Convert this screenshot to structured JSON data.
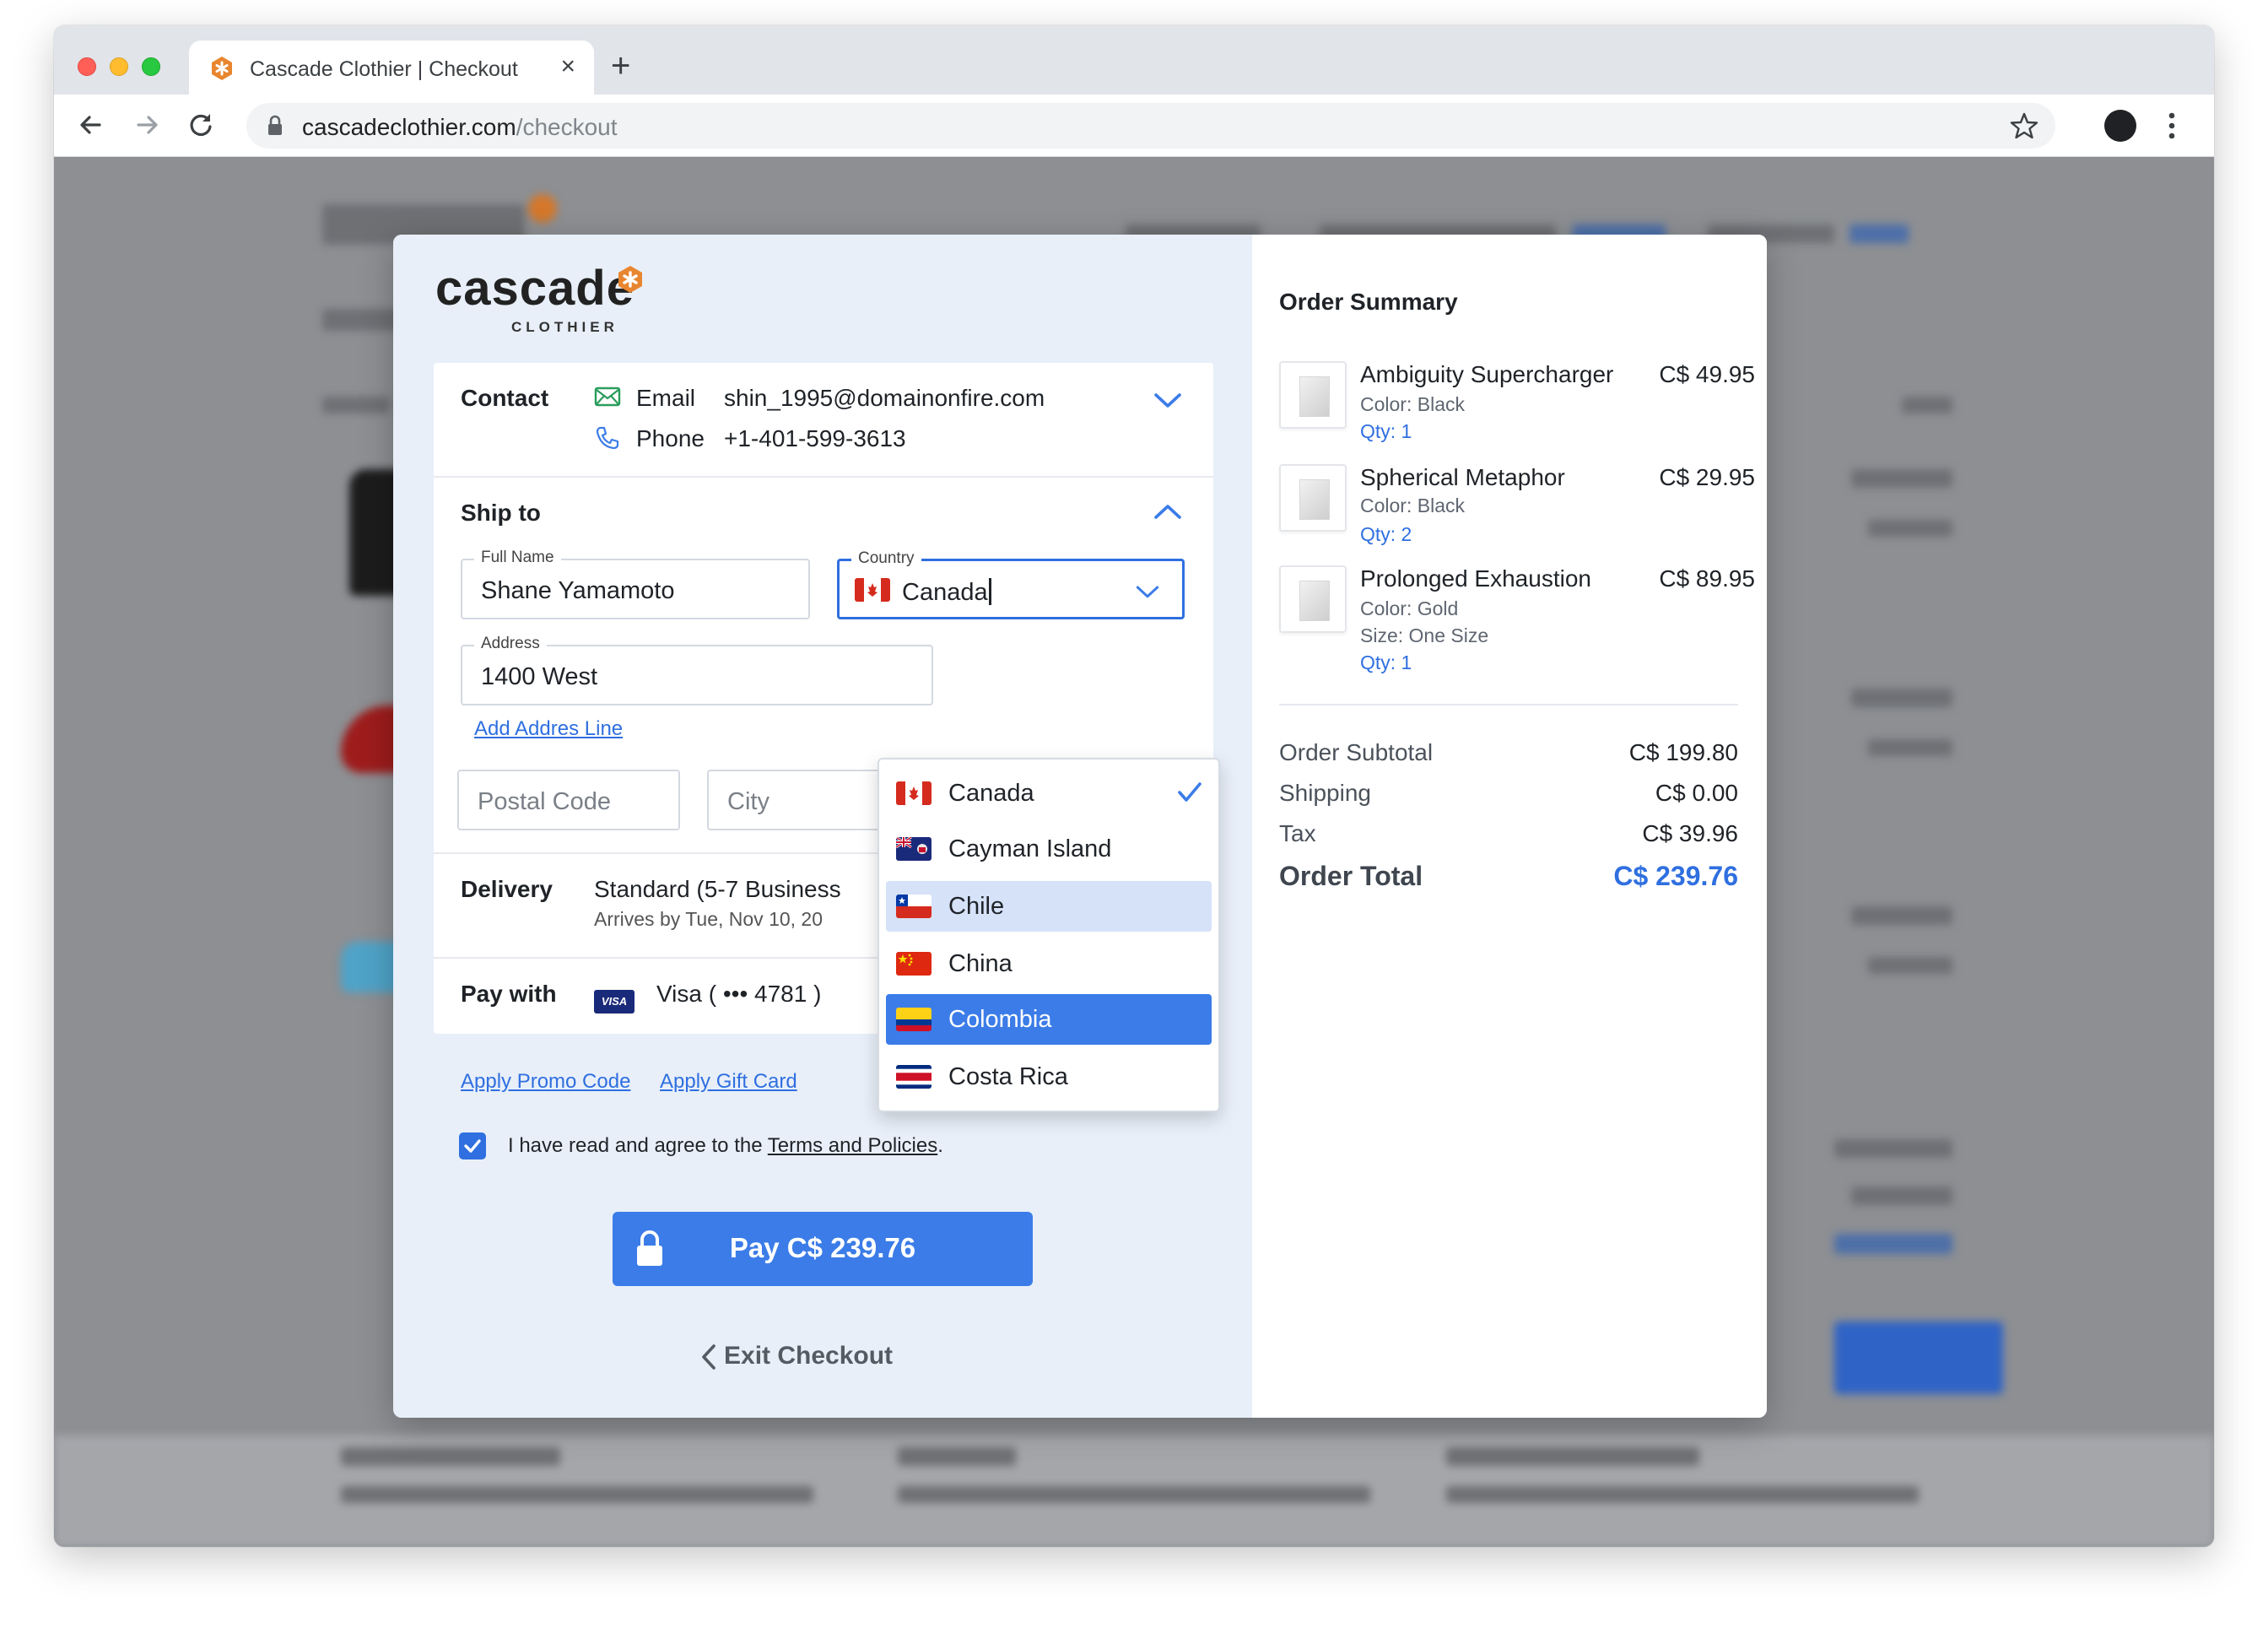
{
  "browser": {
    "tab_title": "Cascade Clothier | Checkout",
    "tab_close": "×",
    "new_tab": "+",
    "url_domain": "cascadeclothier.com",
    "url_path": "/checkout"
  },
  "brand": {
    "name": "cascade",
    "tagline": "CLOTHIER",
    "accent_color": "#E8862F",
    "primary_color": "#3B7CE8"
  },
  "contact": {
    "title": "Contact",
    "email_label": "Email",
    "email_value": "shin_1995@domainonfire.com",
    "phone_label": "Phone",
    "phone_value": "+1-401-599-3613"
  },
  "ship_to": {
    "title": "Ship to",
    "full_name_label": "Full Name",
    "full_name_value": "Shane Yamamoto",
    "country_label": "Country",
    "country_value": "Canada",
    "address_label": "Address",
    "address_value": "1400 West",
    "add_address_line": "Add Addres Line",
    "postal_placeholder": "Postal Code",
    "city_placeholder": "City"
  },
  "country_dropdown": {
    "options": [
      {
        "label": "Canada",
        "flag": "canada-flag",
        "state": "checked"
      },
      {
        "label": "Cayman Island",
        "flag": "cayman-flag",
        "state": ""
      },
      {
        "label": "Chile",
        "flag": "chile-flag",
        "state": "hover"
      },
      {
        "label": "China",
        "flag": "china-flag",
        "state": ""
      },
      {
        "label": "Colombia",
        "flag": "colombia-flag",
        "state": "selected"
      },
      {
        "label": "Costa Rica",
        "flag": "costa-rica-flag",
        "state": ""
      }
    ]
  },
  "delivery": {
    "title": "Delivery",
    "value": "Standard (5-7 Business",
    "arrival": "Arrives by Tue, Nov 10, 20"
  },
  "payment": {
    "title": "Pay with",
    "card_brand": "VISA",
    "card_value": "Visa ( ••• 4781 )"
  },
  "links": {
    "promo": "Apply Promo Code",
    "gift": "Apply Gift Card"
  },
  "agreement": {
    "checked": true,
    "text_prefix": "I have read and agree to the ",
    "link_text": "Terms and Policies",
    "text_suffix": "."
  },
  "pay_button": {
    "label": "Pay C$ 239.76"
  },
  "exit": {
    "label": "Exit Checkout"
  },
  "order_summary": {
    "title": "Order Summary",
    "items": [
      {
        "name": "Ambiguity Supercharger",
        "price": "C$ 49.95",
        "meta": [
          "Color: Black"
        ],
        "qty": "Qty: 1"
      },
      {
        "name": "Spherical Metaphor",
        "price": "C$ 29.95",
        "meta": [
          "Color: Black"
        ],
        "qty": "Qty: 2"
      },
      {
        "name": "Prolonged Exhaustion",
        "price": "C$ 89.95",
        "meta": [
          "Color: Gold",
          "Size: One Size"
        ],
        "qty": "Qty: 1"
      }
    ],
    "subtotal_label": "Order Subtotal",
    "subtotal_value": "C$ 199.80",
    "shipping_label": "Shipping",
    "shipping_value": "C$ 0.00",
    "tax_label": "Tax",
    "tax_value": "C$ 39.96",
    "total_label": "Order Total",
    "total_value": "C$ 239.76"
  }
}
